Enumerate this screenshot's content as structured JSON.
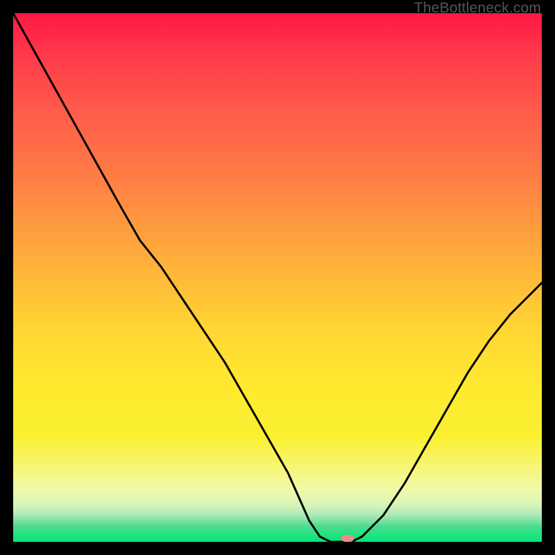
{
  "watermark": "TheBottleneck.com",
  "marker": {
    "x_frac": 0.632,
    "y_frac": 0.994
  },
  "chart_data": {
    "type": "line",
    "title": "",
    "xlabel": "",
    "ylabel": "",
    "xlim": [
      0,
      1
    ],
    "ylim": [
      0,
      1
    ],
    "x": [
      0.0,
      0.05,
      0.1,
      0.15,
      0.2,
      0.24,
      0.28,
      0.32,
      0.36,
      0.4,
      0.44,
      0.48,
      0.52,
      0.56,
      0.58,
      0.6,
      0.62,
      0.64,
      0.66,
      0.7,
      0.74,
      0.78,
      0.82,
      0.86,
      0.9,
      0.94,
      0.98,
      1.0
    ],
    "values": [
      1.0,
      0.91,
      0.82,
      0.73,
      0.64,
      0.57,
      0.52,
      0.46,
      0.4,
      0.34,
      0.27,
      0.2,
      0.13,
      0.04,
      0.01,
      0.0,
      0.0,
      0.0,
      0.01,
      0.05,
      0.11,
      0.18,
      0.25,
      0.32,
      0.38,
      0.43,
      0.47,
      0.49
    ],
    "note": "y is fraction from bottom (0 = bottom / green, 1 = top / red). Values are estimated from the rendered curve; the chart has no numeric axes or tick labels."
  }
}
